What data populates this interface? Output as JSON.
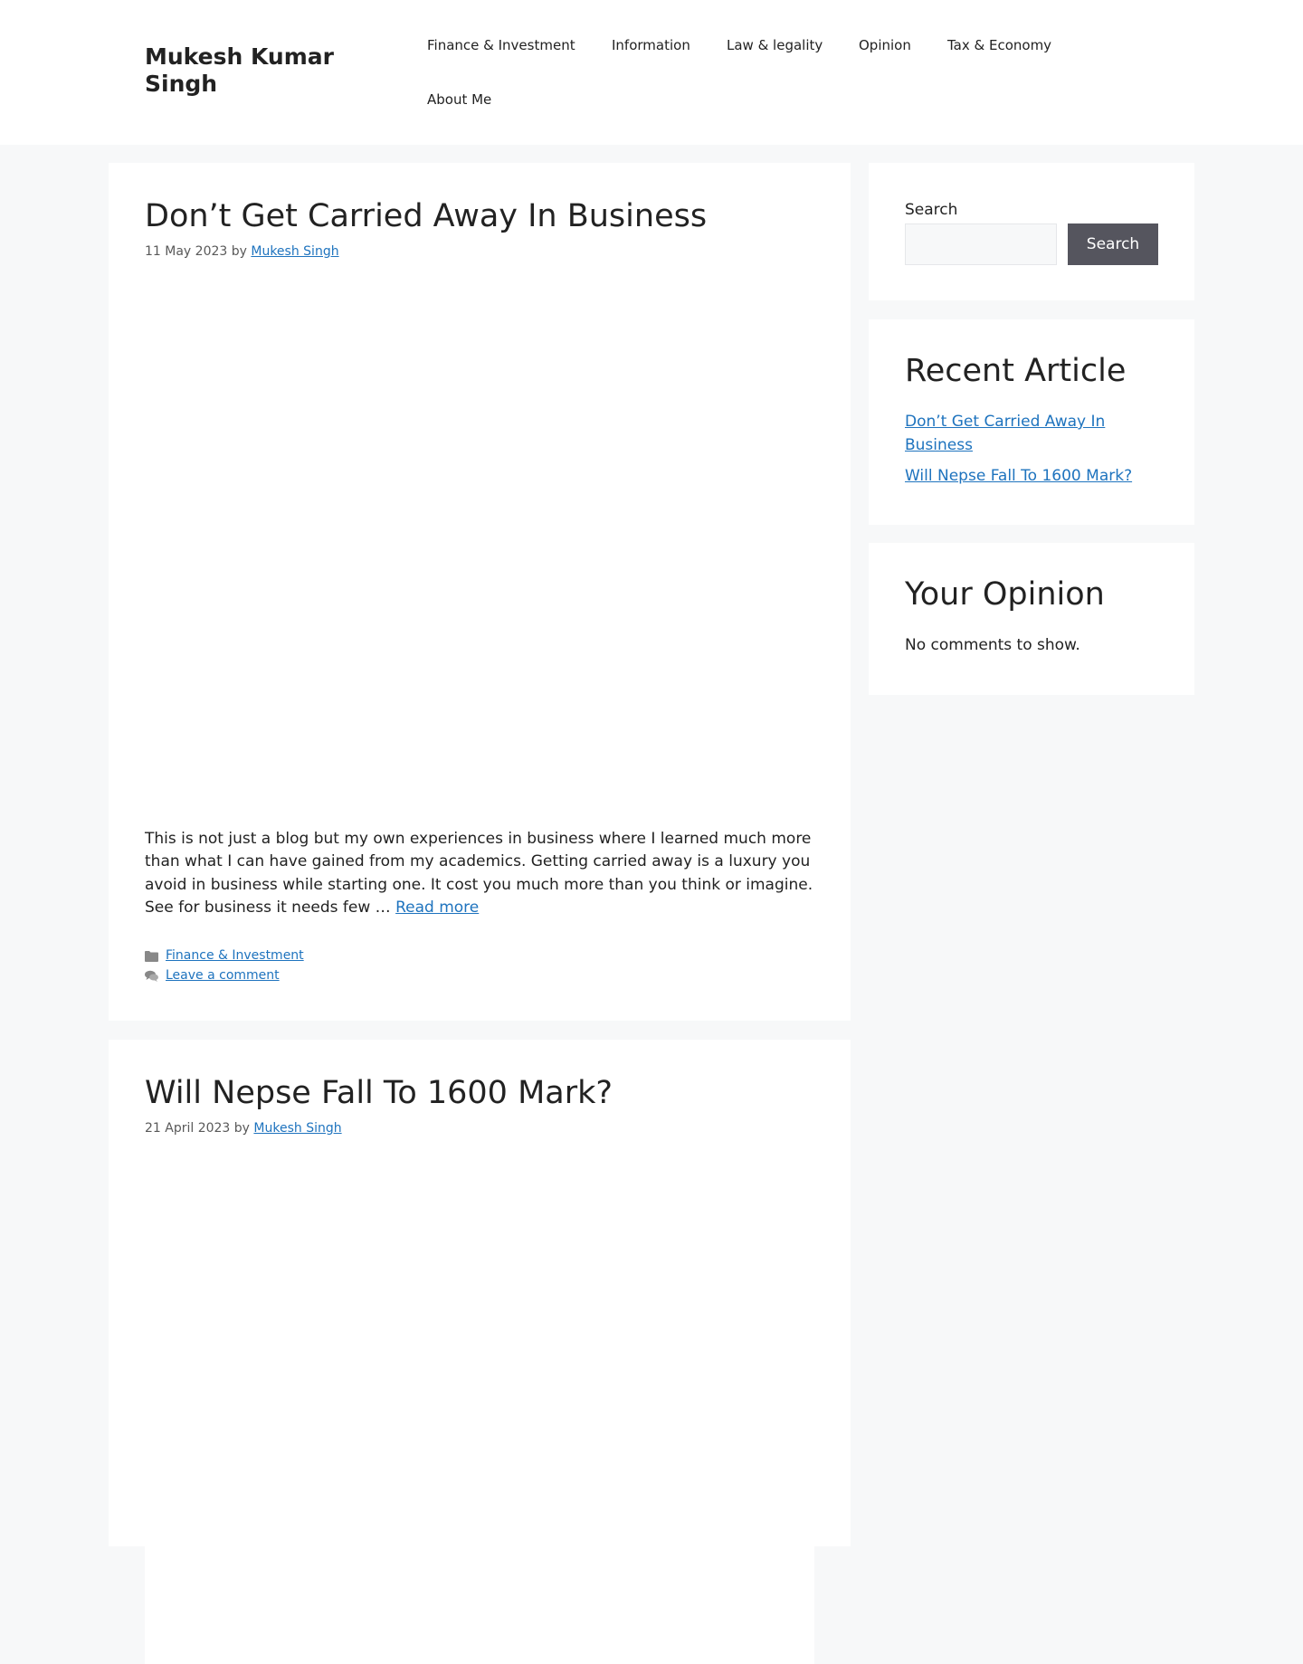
{
  "site": {
    "title": "Mukesh Kumar Singh"
  },
  "nav": {
    "items": [
      "Finance & Investment",
      "Information",
      "Law & legality",
      "Opinion",
      "Tax & Economy",
      "About Me"
    ]
  },
  "posts": [
    {
      "title": "Don’t Get Carried Away In Business",
      "date": "11 May 2023",
      "by": "by",
      "author": "Mukesh Singh",
      "excerpt": "This is not just a blog but my own experiences in business where I learned much more than what I can have gained from my academics. Getting carried away is a luxury you avoid in business while starting one. It cost you much more than you think or imagine. See for business it needs few …",
      "read_more": "Read more",
      "category": "Finance & Investment",
      "comment_link": "Leave a comment"
    },
    {
      "title": "Will Nepse Fall To 1600 Mark?",
      "date": "21 April 2023",
      "by": "by",
      "author": "Mukesh Singh"
    }
  ],
  "sidebar": {
    "search": {
      "label": "Search",
      "placeholder": "",
      "button": "Search"
    },
    "recent": {
      "title": "Recent Article",
      "items": [
        "Don’t Get Carried Away In Business",
        "Will Nepse Fall To 1600 Mark?"
      ]
    },
    "opinion": {
      "title": "Your Opinion",
      "empty": "No comments to show."
    }
  },
  "icons": {
    "category": "folder-icon",
    "comments": "comments-icon"
  },
  "colors": {
    "link": "#1e73be",
    "page_background": "#f7f8f9",
    "button": "#55555e",
    "meta_icon": "#888888"
  }
}
